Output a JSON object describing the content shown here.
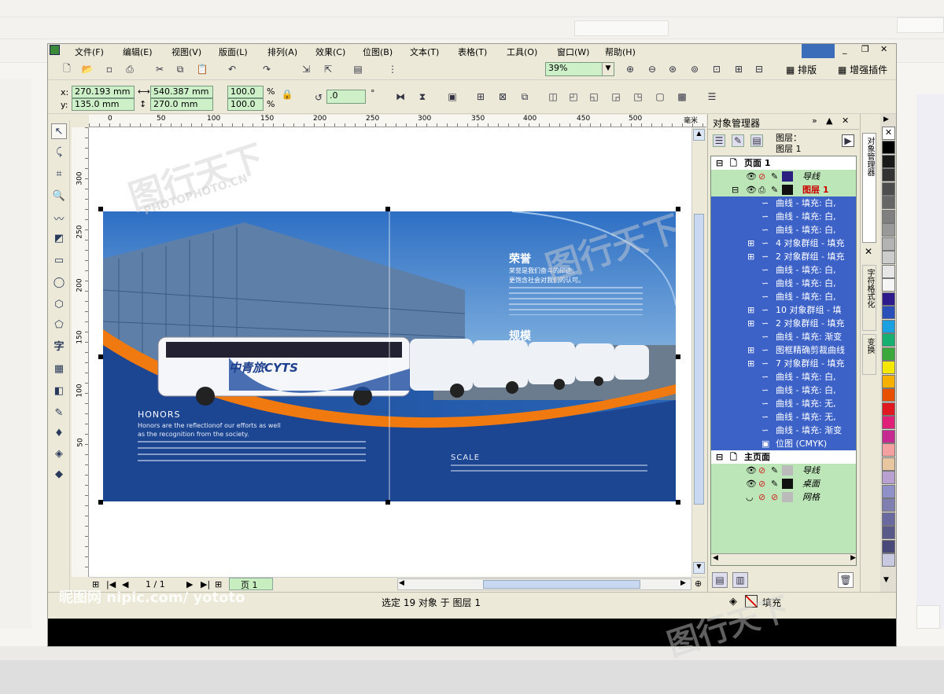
{
  "menu": [
    "文件(F)",
    "编辑(E)",
    "视图(V)",
    "版面(L)",
    "排列(A)",
    "效果(C)",
    "位图(B)",
    "文本(T)",
    "表格(T)",
    "工具(O)",
    "窗口(W)",
    "帮助(H)"
  ],
  "toolbar": {
    "zoom": "39%",
    "layout_button": "排版",
    "plugin_button": "增强插件"
  },
  "property_bar": {
    "x_label": "x:",
    "x": "270.193 mm",
    "y_label": "y:",
    "y": "135.0 mm",
    "width": "540.387 mm",
    "height": "270.0 mm",
    "scale_w": "100.0",
    "scale_h": "100.0",
    "percent": "%",
    "angle": ".0",
    "degree": "°"
  },
  "ruler": {
    "h_ticks": [
      "0",
      "50",
      "100",
      "150",
      "200",
      "250",
      "300",
      "350",
      "400",
      "450",
      "500"
    ],
    "unit": "毫米",
    "v_ticks": [
      "300",
      "250",
      "200",
      "150",
      "100",
      "50"
    ]
  },
  "design": {
    "left_title": "HONORS",
    "left_line1": "Honors are the reflectionof our efforts as well",
    "left_line2": "as the recognition from the society.",
    "bus_brand": "中青旅CYTS",
    "right_title1": "荣誉",
    "right_sub1": "荣誉是我们奋斗的印迹，",
    "right_sub2": "更饱含社会对我们的认可。",
    "right_title2": "规模",
    "scale_title": "SCALE"
  },
  "page_nav": {
    "counter": "1 / 1",
    "tab": "页 1"
  },
  "docker": {
    "title": "对象管理器",
    "layer_label": "图层：",
    "layer_name": "图层 1",
    "page1": "页面 1",
    "guides": "导线",
    "layer1": "图层 1",
    "objects": [
      "曲线 - 填充: 白,",
      "曲线 - 填充: 白,",
      "曲线 - 填充: 白,",
      "4 对象群组 - 填充",
      "2 对象群组 - 填充",
      "曲线 - 填充: 白,",
      "曲线 - 填充: 白,",
      "曲线 - 填充: 白,",
      "10 对象群组 - 填",
      "2 对象群组 - 填充",
      "曲线 - 填充: 渐变",
      "图框精确剪裁曲线",
      "7 对象群组 - 填充",
      "曲线 - 填充: 白,",
      "曲线 - 填充: 白,",
      "曲线 - 填充: 无,",
      "曲线 - 填充: 无,",
      "曲线 - 填充: 渐变",
      "位图 (CMYK)"
    ],
    "master": "主页面",
    "master_guides": "导线",
    "desktop": "桌面",
    "grid": "网格"
  },
  "side_tabs": [
    "对象管理器",
    "字符格式化",
    "变换"
  ],
  "status": {
    "selection": "选定 19 对象 于 图层 1",
    "fill_label": "填充"
  },
  "watermark": {
    "site": "昵图网 nipic.com/ yototo",
    "brand": "图行天下",
    "url": "PHOTOPHOTO.CN"
  },
  "colors": {
    "tree_bg": "#bde6b8",
    "selection": "#3c62c8",
    "field_bg": "#cdf0c8",
    "design_blue": "#1f4e9a",
    "design_orange": "#f07a10"
  },
  "palette": [
    "#ffffff",
    "#000000",
    "#1a1a1a",
    "#333333",
    "#4d4d4d",
    "#666666",
    "#808080",
    "#999999",
    "#b3b3b3",
    "#cccccc",
    "#e6e6e6",
    "#f5f5f5",
    "#2e1a8c",
    "#2a4fb8",
    "#19a0e0",
    "#18b070",
    "#3aa83a",
    "#f5e800",
    "#f5b000",
    "#e85000",
    "#e01820",
    "#e02078",
    "#c62a90",
    "#f4a0a0",
    "#e8c6a0",
    "#b8a0d0",
    "#9090c8",
    "#8080b0",
    "#6a6aa0",
    "#5a5a8a",
    "#4a4a7a",
    "#c8c8e0"
  ]
}
